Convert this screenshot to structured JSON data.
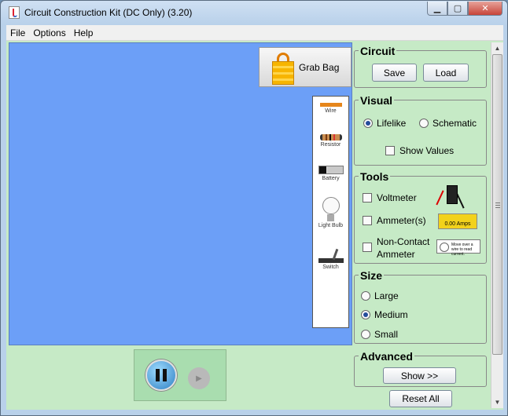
{
  "window": {
    "title": "Circuit Construction Kit (DC Only) (3.20)"
  },
  "menu": [
    "File",
    "Options",
    "Help"
  ],
  "canvas": {
    "grab_bag_label": "Grab Bag",
    "toolbox": [
      "Wire",
      "Resistor",
      "Battery",
      "Light Bulb",
      "Switch"
    ]
  },
  "panels": {
    "circuit": {
      "title": "Circuit",
      "save": "Save",
      "load": "Load"
    },
    "visual": {
      "title": "Visual",
      "lifelike": "Lifelike",
      "schematic": "Schematic",
      "show_values": "Show Values",
      "selected": "Lifelike"
    },
    "tools": {
      "title": "Tools",
      "voltmeter": "Voltmeter",
      "ammeter": "Ammeter(s)",
      "noncontact_1": "Non-Contact",
      "noncontact_2": "Ammeter",
      "ammeter_readout": "0.00 Amps",
      "nc_hint": "Move over a wire to read current."
    },
    "size": {
      "title": "Size",
      "large": "Large",
      "medium": "Medium",
      "small": "Small",
      "selected": "Medium"
    },
    "advanced": {
      "title": "Advanced",
      "show": "Show >>"
    },
    "reset": "Reset All"
  },
  "colors": {
    "canvas": "#6c9ff7",
    "panel_bg": "#c6eac6"
  }
}
